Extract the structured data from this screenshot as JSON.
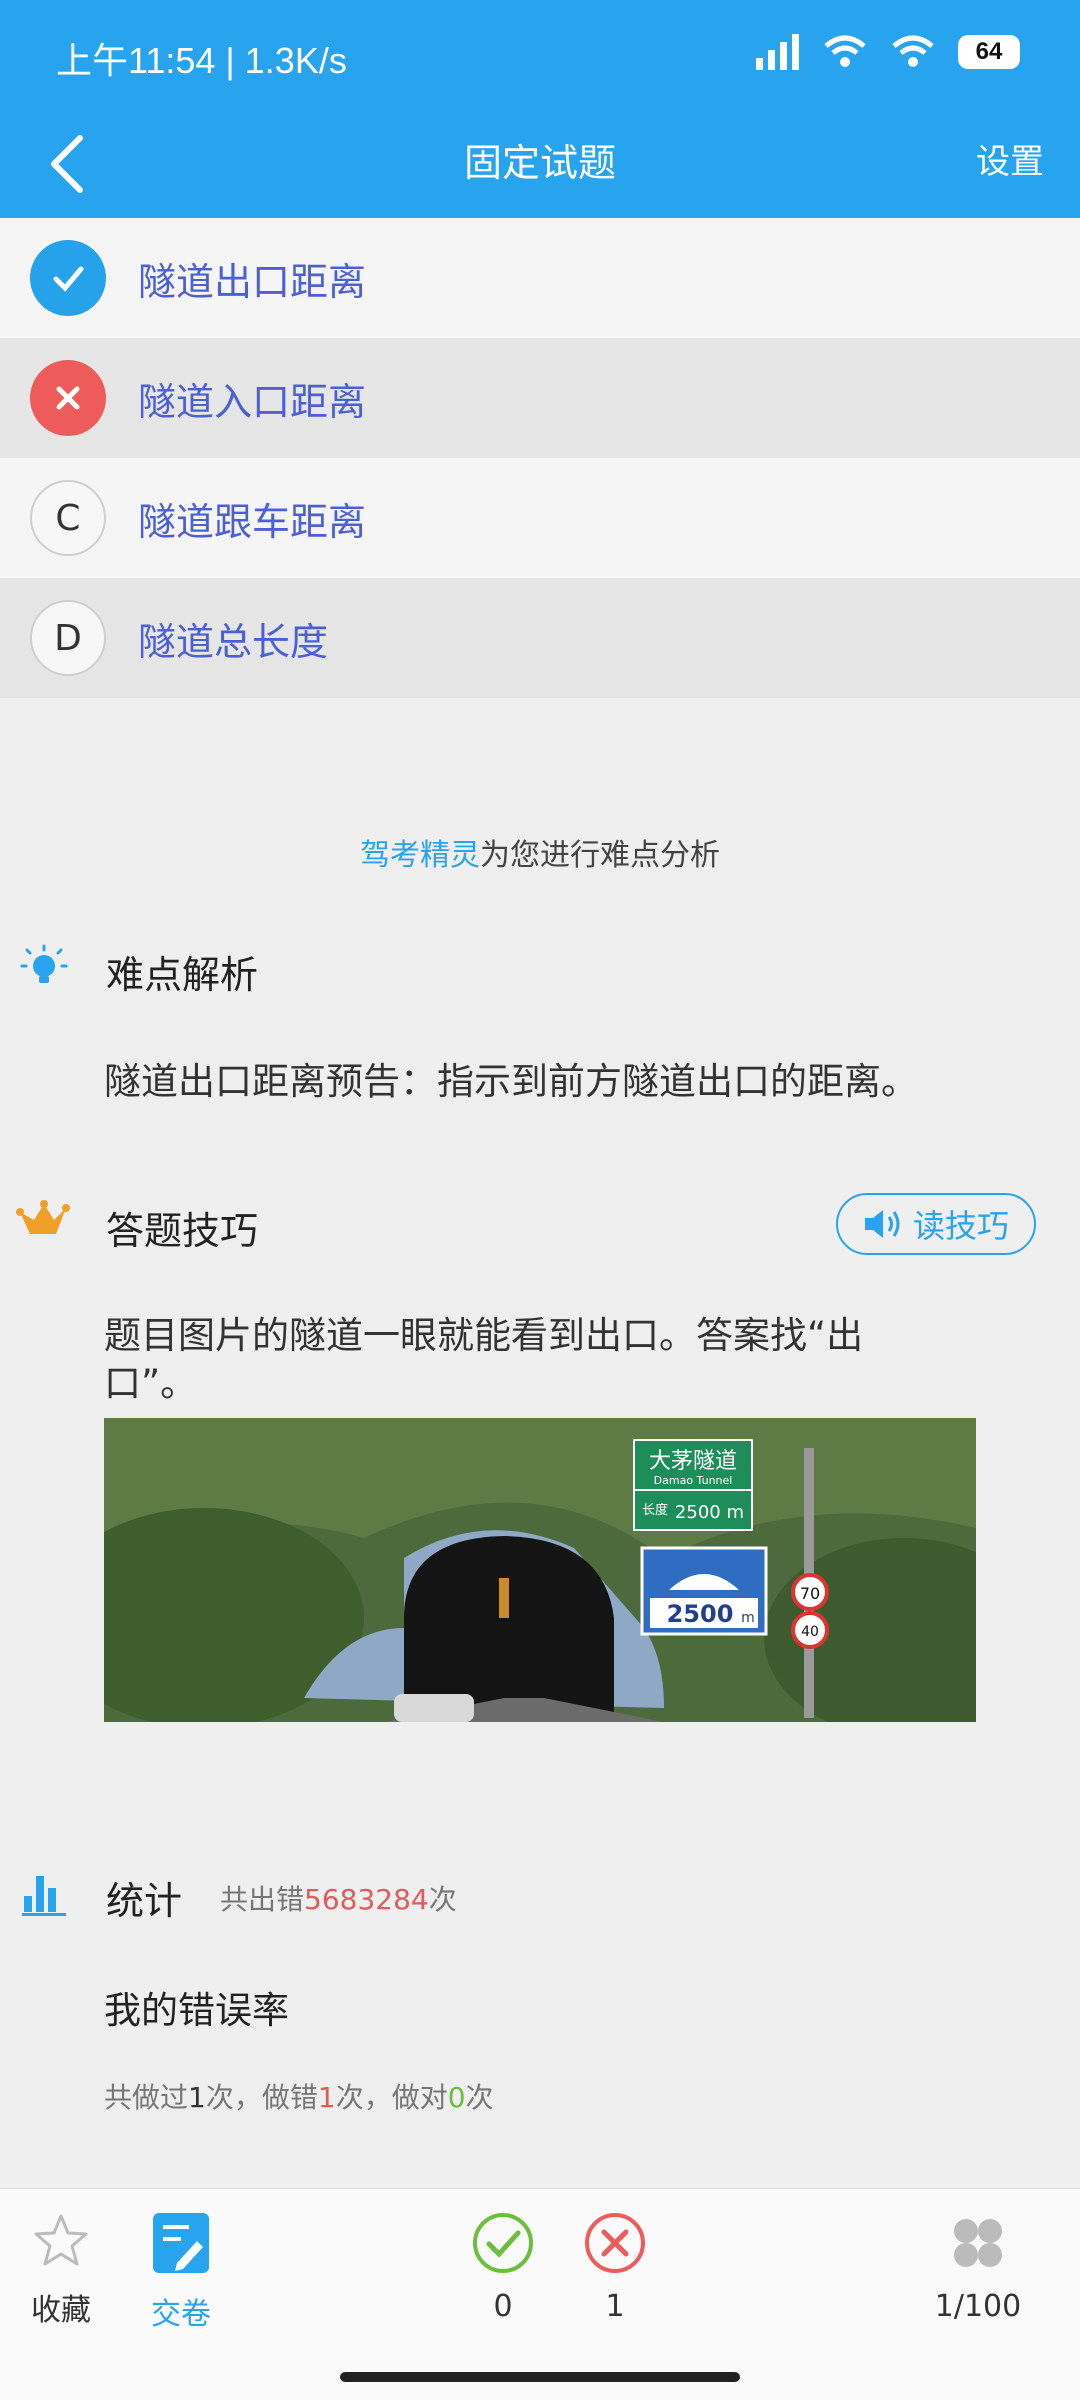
{
  "status_bar": {
    "time": "上午11:54 | 1.3K/s",
    "battery": "64"
  },
  "navbar": {
    "title": "固定试题",
    "settings": "设置"
  },
  "options": [
    {
      "marker": "",
      "text": "隧道出口距离",
      "state": "correct"
    },
    {
      "marker": "",
      "text": "隧道入口距离",
      "state": "wrong"
    },
    {
      "marker": "C",
      "text": "隧道跟车距离",
      "state": "none"
    },
    {
      "marker": "D",
      "text": "隧道总长度",
      "state": "none"
    }
  ],
  "analysis_helper": {
    "brand": "驾考精灵",
    "rest": "为您进行难点分析"
  },
  "difficulty": {
    "title": "难点解析",
    "text": "隧道出口距离预告：指示到前方隧道出口的距离。"
  },
  "tips": {
    "title": "答题技巧",
    "read_button": "读技巧",
    "text": "题目图片的隧道一眼就能看到出口。答案找“出口”。"
  },
  "image_signs": {
    "name_cn": "大茅隧道",
    "name_en": "Damao Tunnel",
    "length_label": "长度",
    "length_value": "2500 m",
    "distance": "2500",
    "distance_unit": "m",
    "speed_limit": "70",
    "min_speed": "40"
  },
  "stats": {
    "title": "统计",
    "total_errors_prefix": "共出错",
    "total_errors_value": "5683284",
    "total_errors_suffix": "次",
    "my_error_title": "我的错误率",
    "did_prefix": "共做过",
    "did_count": "1",
    "wrong_prefix": "次，做错",
    "wrong_count": "1",
    "right_prefix": "次，做对",
    "right_count": "0",
    "right_suffix": "次"
  },
  "bottom_bar": {
    "favorite": "收藏",
    "submit": "交卷",
    "correct_count": "0",
    "wrong_count": "1",
    "progress": "1/100"
  },
  "colors": {
    "primary": "#28a3ee",
    "correct": "#26a2eb",
    "wrong": "#ee5b5b",
    "green": "#6bbf3a"
  }
}
